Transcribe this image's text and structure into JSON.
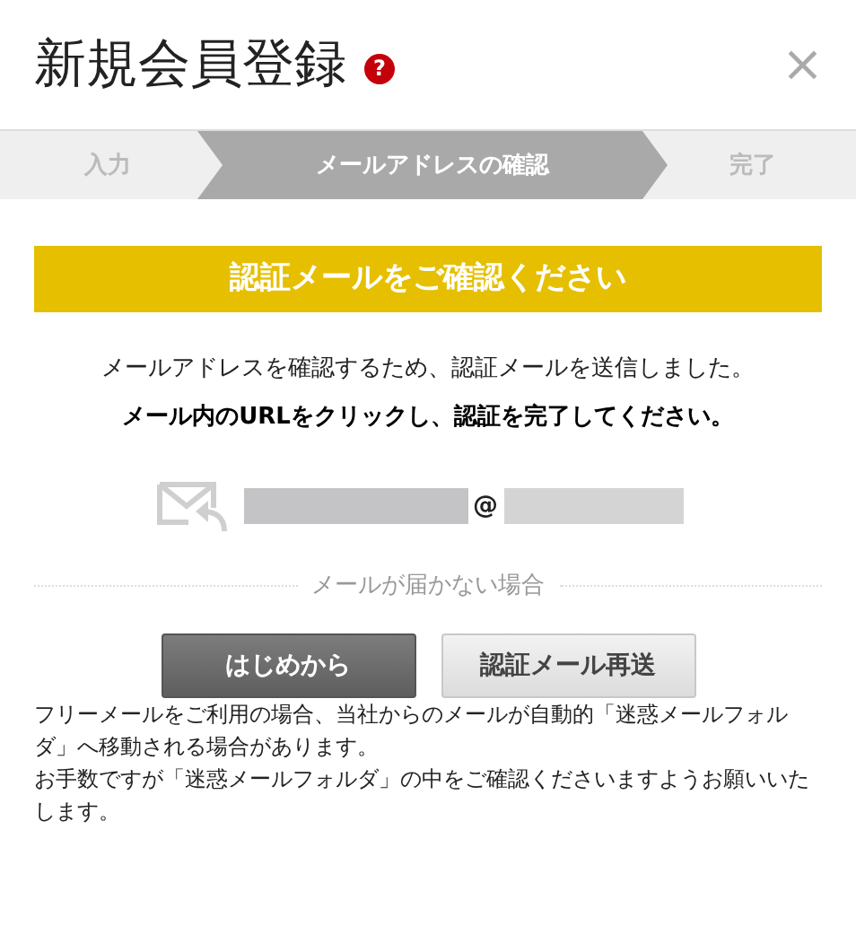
{
  "dialog": {
    "title": "新規会員登録",
    "help_icon": "?",
    "close": "×"
  },
  "steps": [
    {
      "label": "入力",
      "selected": false
    },
    {
      "label": "メールアドレスの確認",
      "selected": true
    },
    {
      "label": "完了",
      "selected": false
    }
  ],
  "banner": "認証メールをご確認ください",
  "message": "メールアドレスを確認するため、認証メールを送信しました。",
  "instruction": "メール内のURLをクリックし、認証を完了してください。",
  "email": {
    "at": "@"
  },
  "divider_label": "メールが届かない場合",
  "buttons": [
    {
      "label": "はじめから",
      "kind": "primary"
    },
    {
      "label": "認証メール再送",
      "kind": "secondary"
    }
  ],
  "notes": [
    "フリーメールをご利用の場合、当社からのメールが自動的「迷惑メールフォルダ」へ移動される場合があります。",
    "お手数ですが「迷惑メールフォルダ」の中をご確認くださいますようお願いいたします。"
  ]
}
